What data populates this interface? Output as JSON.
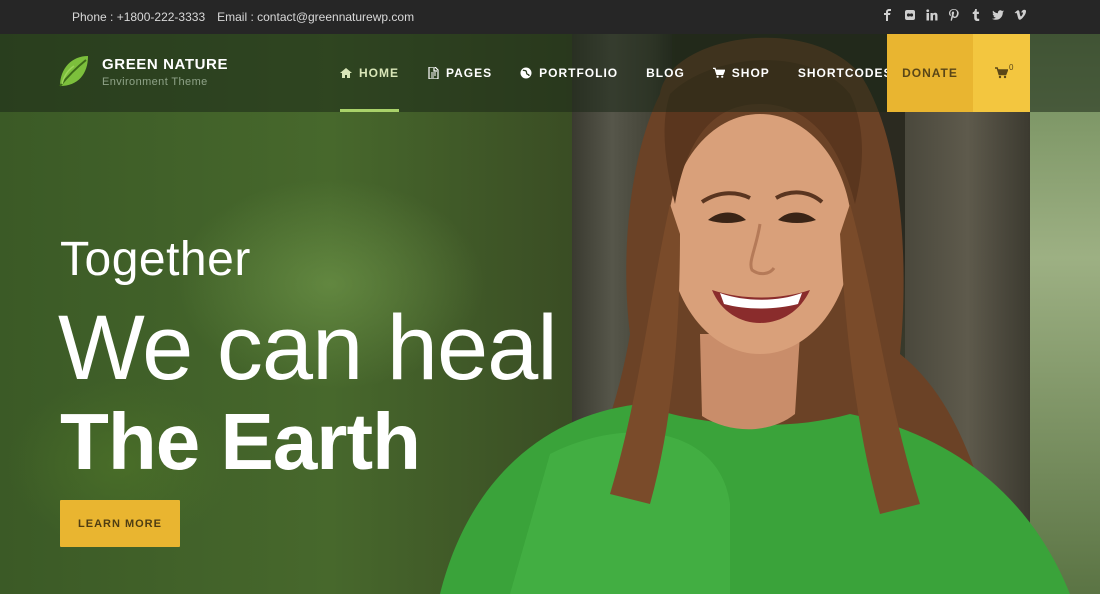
{
  "topbar": {
    "phone": "Phone : +1800-222-3333",
    "email": "Email : contact@greennaturewp.com",
    "social": [
      "facebook-icon",
      "flickr-icon",
      "linkedin-icon",
      "pinterest-icon",
      "tumblr-icon",
      "twitter-icon",
      "vimeo-icon"
    ]
  },
  "logo": {
    "name": "GREEN NATURE",
    "tagline": "Environment Theme"
  },
  "nav": {
    "items": [
      {
        "label": "HOME",
        "icon": "home-icon",
        "active": true
      },
      {
        "label": "PAGES",
        "icon": "document-icon"
      },
      {
        "label": "PORTFOLIO",
        "icon": "globe-icon"
      },
      {
        "label": "BLOG"
      },
      {
        "label": "SHOP",
        "icon": "cart-icon"
      },
      {
        "label": "SHORTCODES"
      }
    ],
    "donate": "DONATE",
    "cart_count": "0"
  },
  "hero": {
    "line1": "Together",
    "line2": "We can heal",
    "line3": "The Earth",
    "cta": "LEARN MORE"
  },
  "colors": {
    "accent": "#e9b530",
    "cart_bg": "#f3c63f",
    "nav_active": "#a9d26a",
    "topbar": "#262626"
  }
}
